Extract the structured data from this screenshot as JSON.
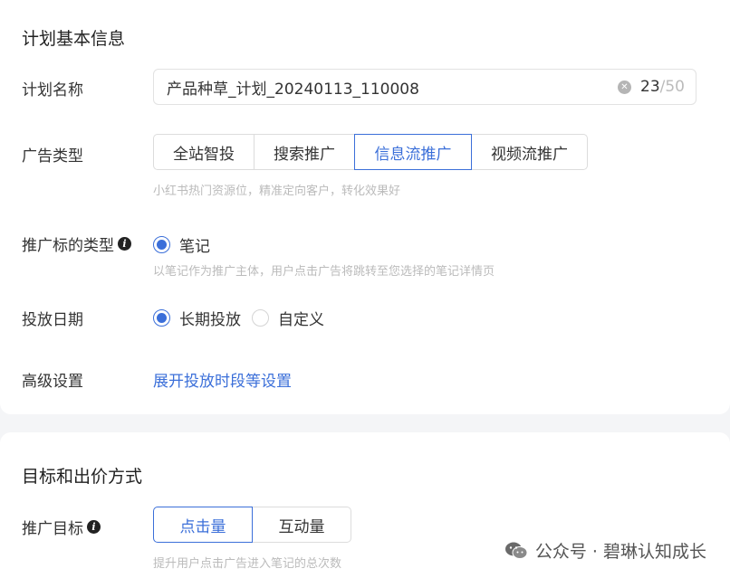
{
  "basic_info": {
    "title": "计划基本信息",
    "plan_name": {
      "label": "计划名称",
      "value": "产品种草_计划_20240113_110008",
      "count": "23",
      "max": "/50"
    },
    "ad_type": {
      "label": "广告类型",
      "options": [
        "全站智投",
        "搜索推广",
        "信息流推广",
        "视频流推广"
      ],
      "selected": "信息流推广",
      "hint": "小红书热门资源位，精准定向客户，转化效果好"
    },
    "promo_type": {
      "label": "推广标的类型",
      "option": "笔记",
      "hint": "以笔记作为推广主体，用户点击广告将跳转至您选择的笔记详情页"
    },
    "schedule": {
      "label": "投放日期",
      "options": [
        "长期投放",
        "自定义"
      ],
      "selected": "长期投放"
    },
    "advanced": {
      "label": "高级设置",
      "link": "展开投放时段等设置"
    }
  },
  "goal_bid": {
    "title": "目标和出价方式",
    "goal": {
      "label": "推广目标",
      "options": [
        "点击量",
        "互动量"
      ],
      "selected": "点击量",
      "hint": "提升用户点击广告进入笔记的总次数"
    }
  },
  "watermark": {
    "text": "公众号 · 碧琳认知成长"
  },
  "colors": {
    "accent": "#3b6fd9",
    "hint": "#bbbbbb"
  }
}
